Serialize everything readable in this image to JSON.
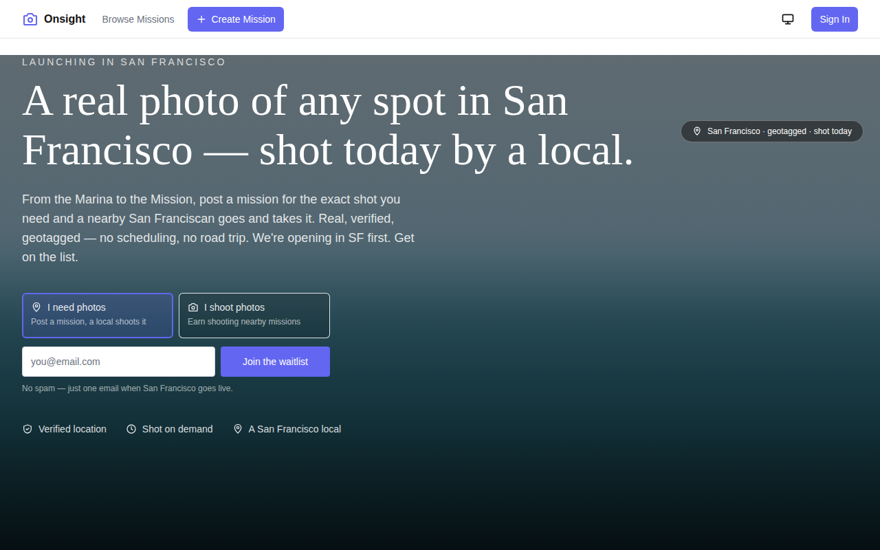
{
  "nav": {
    "brand": "Onsight",
    "links": [
      {
        "label": "Browse Missions"
      }
    ],
    "create_button": "Create Mission",
    "sign_in": "Sign In"
  },
  "hero": {
    "eyebrow": "LAUNCHING IN SAN FRANCISCO",
    "headline": "A real photo of any spot in San Francisco — shot today by a local.",
    "subtitle": "From the Marina to the Mission, post a mission for the exact shot you need and a nearby San Franciscan goes and takes it. Real, verified, geotagged — no scheduling, no road trip. We're opening in SF first. Get on the list.",
    "badge": "San Francisco · geotagged · shot today",
    "roles": [
      {
        "label": "I need photos",
        "description": "Post a mission, a local shoots it",
        "kind": "need",
        "selected": true
      },
      {
        "label": "I shoot photos",
        "description": "Earn shooting nearby missions",
        "kind": "shoot",
        "selected": false
      }
    ],
    "email_placeholder": "you@email.com",
    "submit": "Join the waitlist",
    "note": "No spam — just one email when San Francisco goes live.",
    "features": [
      {
        "label": "Verified location",
        "kind": "shield"
      },
      {
        "label": "Shot on demand",
        "kind": "clock"
      },
      {
        "label": "A San Francisco local",
        "kind": "pin"
      }
    ]
  }
}
